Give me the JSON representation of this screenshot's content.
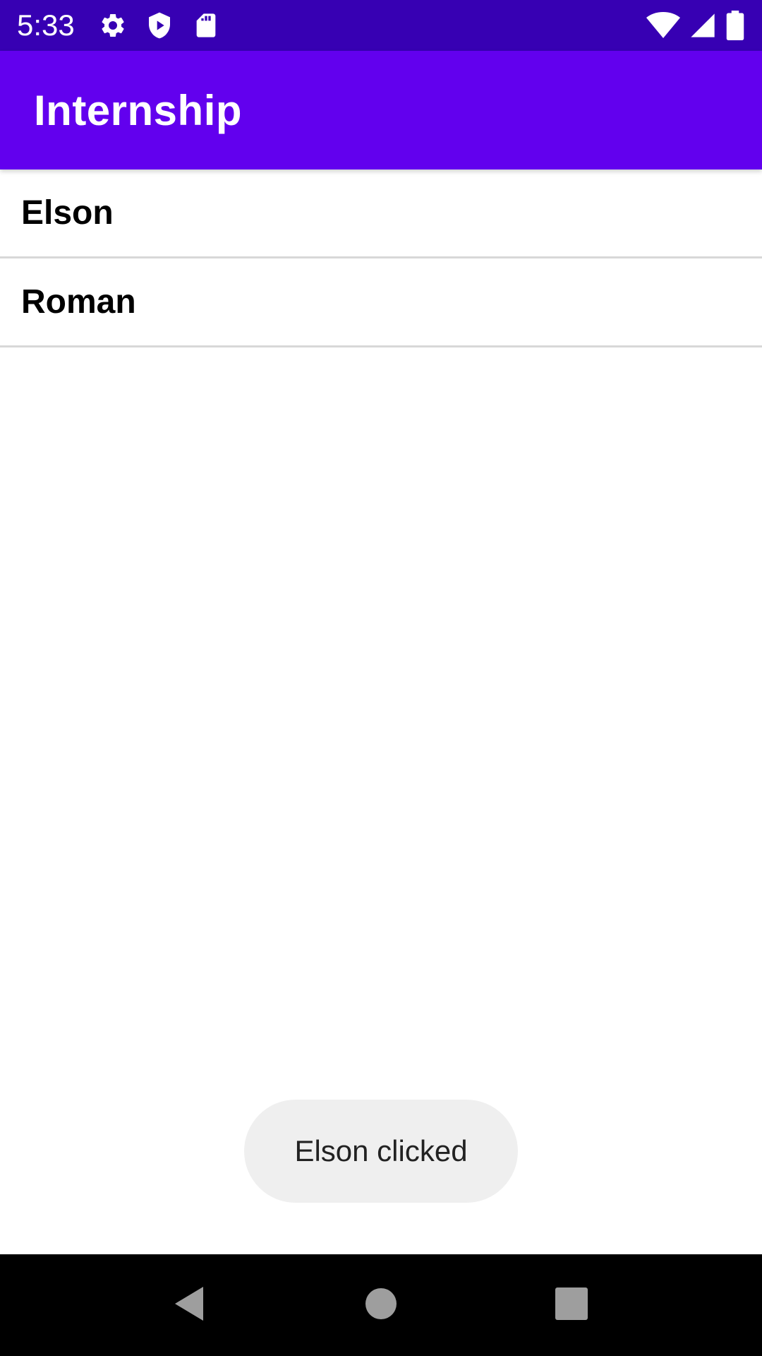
{
  "colors": {
    "status_bar": "#3700b3",
    "app_bar": "#6200ee",
    "toast_bg": "#efefef",
    "nav_bar": "#000000",
    "nav_icon": "#9e9e9e"
  },
  "status_bar": {
    "time": "5:33",
    "left_icons": [
      "gear-icon",
      "shield-play-icon",
      "sd-card-icon"
    ],
    "right_icons": [
      "wifi-icon",
      "cellular-signal-icon",
      "battery-icon"
    ]
  },
  "app_bar": {
    "title": "Internship"
  },
  "list": {
    "items": [
      {
        "label": "Elson"
      },
      {
        "label": "Roman"
      }
    ]
  },
  "toast": {
    "text": "Elson clicked"
  },
  "nav_bar": {
    "buttons": [
      "back-icon",
      "home-icon",
      "recents-icon"
    ]
  }
}
